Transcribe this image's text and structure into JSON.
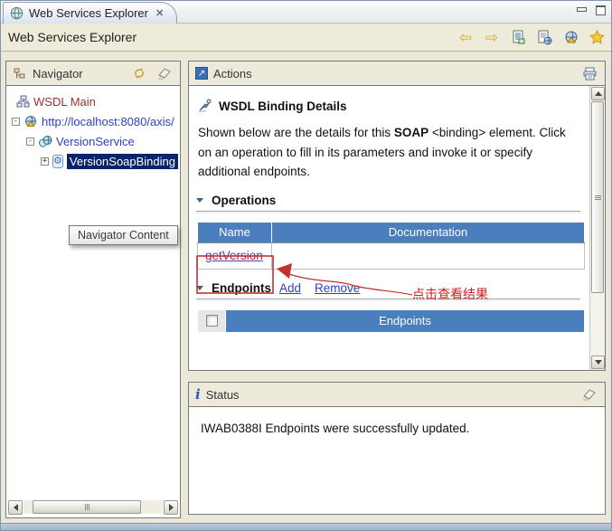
{
  "tab": {
    "title": "Web Services Explorer"
  },
  "icons": {
    "close": "✕",
    "back": "⇦",
    "forward": "⇨",
    "gear": "⚙",
    "form_arrow": "↗",
    "info": "i",
    "expander_collapsed": "+",
    "expander_expanded": "-"
  },
  "banner": {
    "title": "Web Services Explorer"
  },
  "navigator": {
    "title": "Navigator",
    "tooltip": "Navigator Content",
    "tree": [
      {
        "label": "WSDL Main"
      },
      {
        "label": "http://localhost:8080/axis/"
      },
      {
        "label": "VersionService"
      },
      {
        "label": "VersionSoapBinding"
      }
    ]
  },
  "actions": {
    "title": "Actions",
    "heading": "WSDL Binding Details",
    "description": {
      "part1": "Shown below are the details for this ",
      "bold": "SOAP",
      "part2": " <binding> element. Click on an operation to fill in its parameters and invoke it or specify additional endpoints."
    },
    "operations": {
      "title": "Operations",
      "columns": [
        "Name",
        "Documentation"
      ],
      "rows": [
        {
          "name": "getVersion",
          "documentation": ""
        }
      ]
    },
    "annotation": {
      "text": "点击查看结果"
    },
    "endpoints": {
      "title": "Endpoints",
      "add_label": "Add",
      "remove_label": "Remove",
      "column_header": "Endpoints",
      "checkbox_checked": false
    }
  },
  "status": {
    "title": "Status",
    "message": "IWAB0388I Endpoints were successfully updated."
  },
  "colors": {
    "table_header_blue": "#4a7ebc",
    "selection_navy": "#0a246a",
    "link_blue": "#2a41c5",
    "visited_link_purple": "#7b2d90",
    "annotation_red": "#cc2020",
    "tree_root_maroon": "#993333",
    "panel_beige": "#eeeadb"
  }
}
